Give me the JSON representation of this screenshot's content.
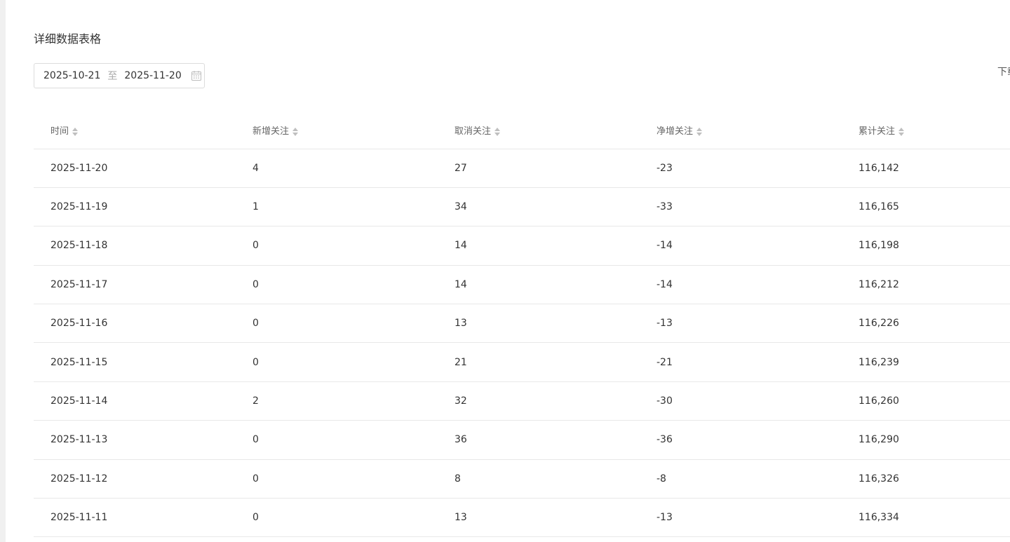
{
  "section": {
    "title": "详细数据表格",
    "download_label": "下载"
  },
  "date_range": {
    "start": "2025-10-21",
    "separator": "至",
    "end": "2025-11-20"
  },
  "table": {
    "columns": [
      "时间",
      "新增关注",
      "取消关注",
      "净增关注",
      "累计关注"
    ],
    "rows": [
      [
        "2025-11-20",
        "4",
        "27",
        "-23",
        "116,142"
      ],
      [
        "2025-11-19",
        "1",
        "34",
        "-33",
        "116,165"
      ],
      [
        "2025-11-18",
        "0",
        "14",
        "-14",
        "116,198"
      ],
      [
        "2025-11-17",
        "0",
        "14",
        "-14",
        "116,212"
      ],
      [
        "2025-11-16",
        "0",
        "13",
        "-13",
        "116,226"
      ],
      [
        "2025-11-15",
        "0",
        "21",
        "-21",
        "116,239"
      ],
      [
        "2025-11-14",
        "2",
        "32",
        "-30",
        "116,260"
      ],
      [
        "2025-11-13",
        "0",
        "36",
        "-36",
        "116,290"
      ],
      [
        "2025-11-12",
        "0",
        "8",
        "-8",
        "116,326"
      ],
      [
        "2025-11-11",
        "0",
        "13",
        "-13",
        "116,334"
      ]
    ]
  }
}
